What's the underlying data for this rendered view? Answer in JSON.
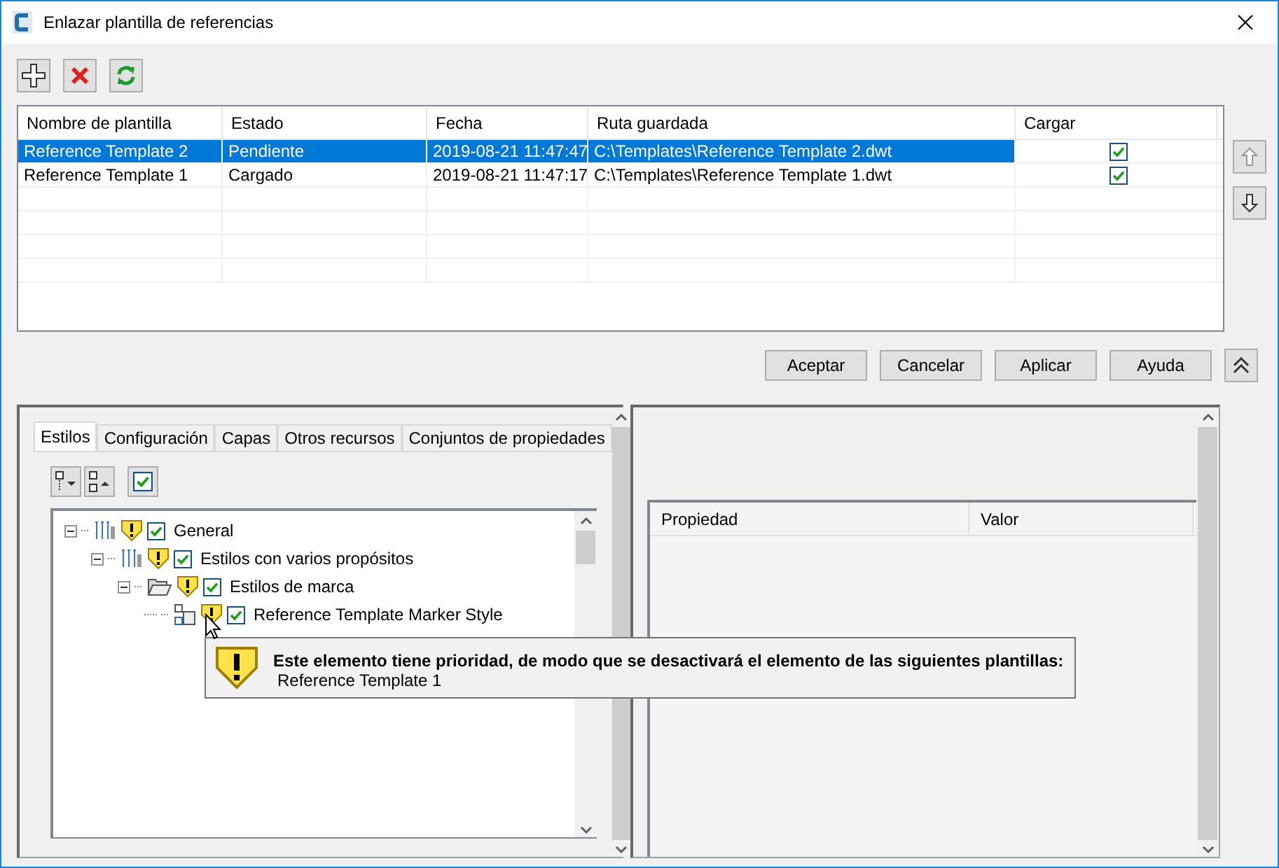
{
  "window": {
    "title": "Enlazar plantilla de referencias"
  },
  "templates": {
    "columns": [
      "Nombre de plantilla",
      "Estado",
      "Fecha",
      "Ruta guardada",
      "Cargar"
    ],
    "rows": [
      {
        "name": "Reference Template 2",
        "status": "Pendiente",
        "date": "2019-08-21 11:47:47",
        "path": "C:\\Templates\\Reference Template 2.dwt",
        "load": true,
        "selected": true
      },
      {
        "name": "Reference Template 1",
        "status": "Cargado",
        "date": "2019-08-21 11:47:17",
        "path": "C:\\Templates\\Reference Template 1.dwt",
        "load": true,
        "selected": false
      }
    ]
  },
  "buttons": [
    "Aceptar",
    "Cancelar",
    "Aplicar",
    "Ayuda"
  ],
  "tabs": [
    {
      "label": "Estilos",
      "selected": true
    },
    {
      "label": "Configuración",
      "selected": false
    },
    {
      "label": "Capas",
      "selected": false
    },
    {
      "label": "Otros recursos",
      "selected": false
    },
    {
      "label": "Conjuntos de propiedades",
      "selected": false
    }
  ],
  "tree": [
    {
      "label": "General",
      "kind": "group",
      "warning": true,
      "checked": true,
      "expanded": true,
      "children": [
        {
          "label": "Estilos con varios propósitos",
          "kind": "group",
          "warning": true,
          "checked": true,
          "expanded": true,
          "children": [
            {
              "label": "Estilos de marca",
              "kind": "folder",
              "warning": true,
              "checked": true,
              "expanded": true,
              "children": [
                {
                  "label": "Reference Template Marker Style",
                  "kind": "style",
                  "warning": true,
                  "checked": true
                }
              ]
            }
          ]
        }
      ]
    }
  ],
  "tooltip": {
    "message": "Este elemento tiene prioridad, de modo que se desactivará el elemento de las siguientes plantillas:",
    "items": [
      "Reference Template 1"
    ]
  },
  "properties": {
    "columns": [
      "Propiedad",
      "Valor"
    ]
  }
}
